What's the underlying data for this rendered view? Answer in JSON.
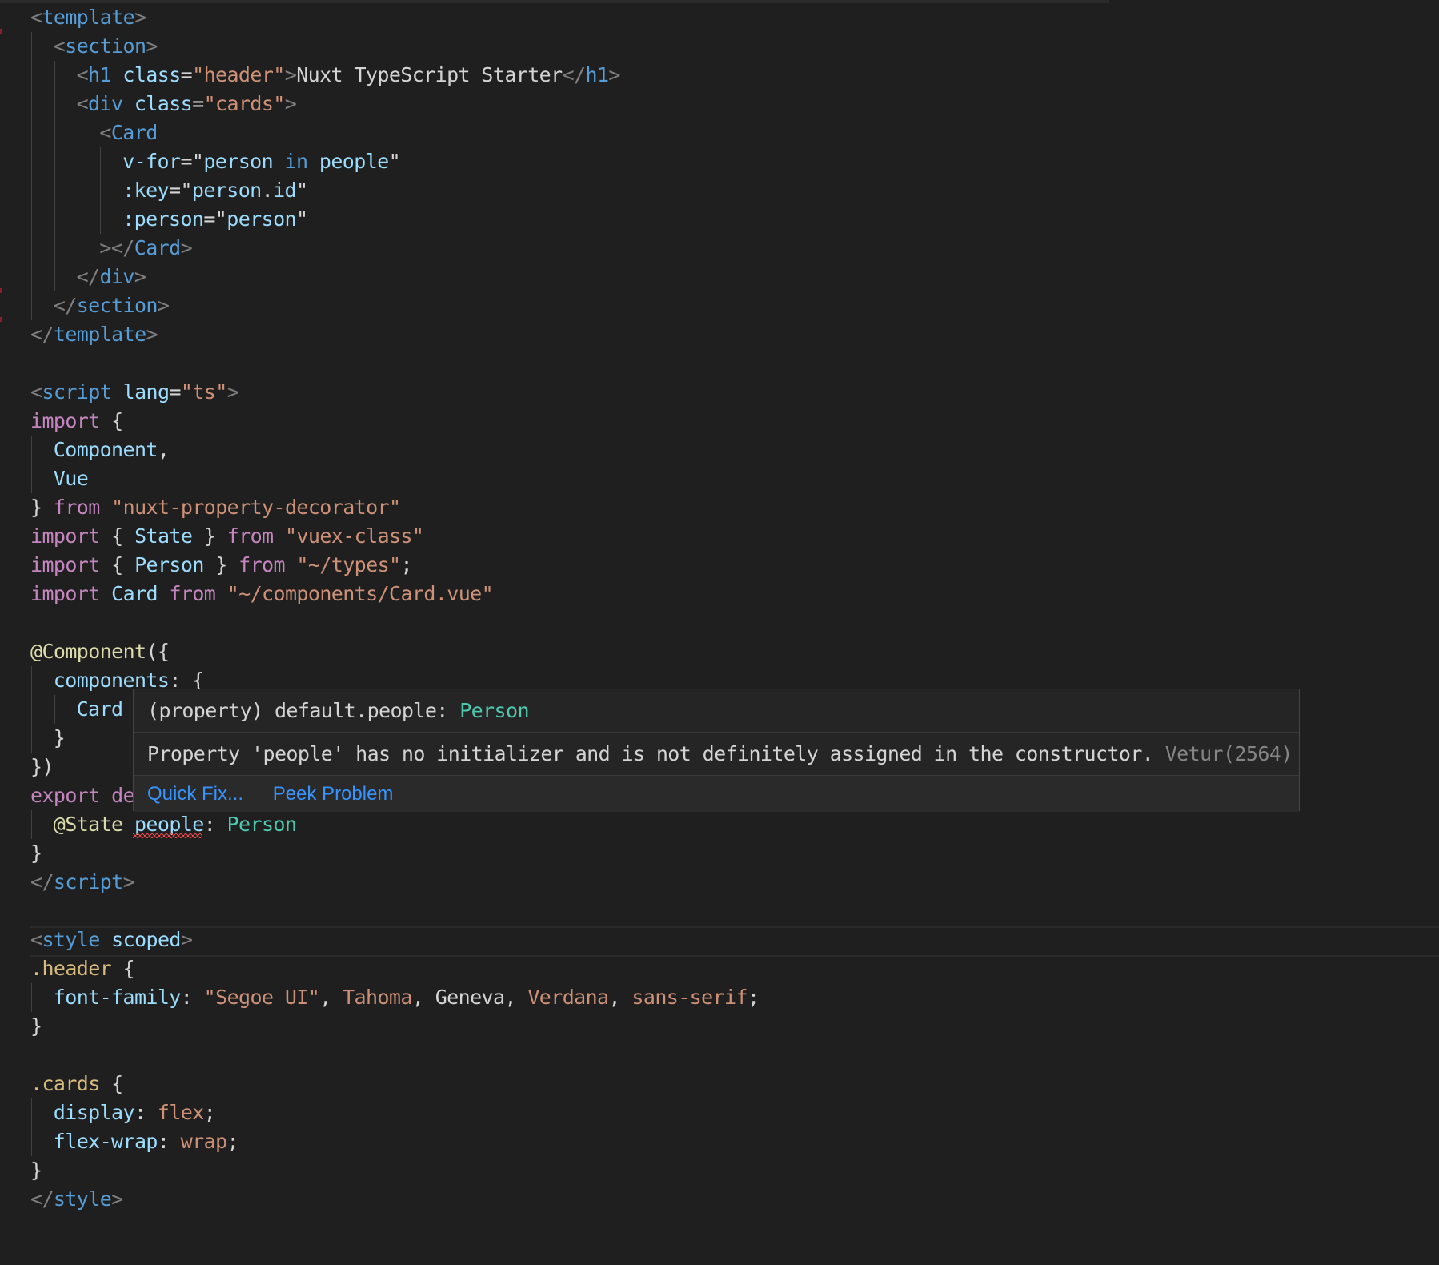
{
  "editor": {
    "lines": [
      [
        [
          "tag",
          "<"
        ],
        [
          "name",
          "template"
        ],
        [
          "tag",
          ">"
        ]
      ],
      [
        [
          "tag",
          "<"
        ],
        [
          "name",
          "section"
        ],
        [
          "tag",
          ">"
        ]
      ],
      [
        [
          "tag",
          "<"
        ],
        [
          "name",
          "h1"
        ],
        [
          "txt",
          " "
        ],
        [
          "attr",
          "class"
        ],
        [
          "txt",
          "="
        ],
        [
          "str",
          "\"header\""
        ],
        [
          "tag",
          ">"
        ],
        [
          "txt",
          "Nuxt TypeScript Starter"
        ],
        [
          "tag",
          "</"
        ],
        [
          "name",
          "h1"
        ],
        [
          "tag",
          ">"
        ]
      ],
      [
        [
          "tag",
          "<"
        ],
        [
          "name",
          "div"
        ],
        [
          "txt",
          " "
        ],
        [
          "attr",
          "class"
        ],
        [
          "txt",
          "="
        ],
        [
          "str",
          "\"cards\""
        ],
        [
          "tag",
          ">"
        ]
      ],
      [
        [
          "tag",
          "<"
        ],
        [
          "name",
          "Card"
        ]
      ],
      [
        [
          "attr",
          "v-for"
        ],
        [
          "txt",
          "=\""
        ],
        [
          "id",
          "person"
        ],
        [
          "txt",
          " "
        ],
        [
          "name",
          "in"
        ],
        [
          "txt",
          " "
        ],
        [
          "id",
          "people"
        ],
        [
          "txt",
          "\""
        ]
      ],
      [
        [
          "attr",
          ":key"
        ],
        [
          "txt",
          "=\""
        ],
        [
          "id",
          "person"
        ],
        [
          "txt",
          "."
        ],
        [
          "id",
          "id"
        ],
        [
          "txt",
          "\""
        ]
      ],
      [
        [
          "attr",
          ":person"
        ],
        [
          "txt",
          "=\""
        ],
        [
          "id",
          "person"
        ],
        [
          "txt",
          "\""
        ]
      ],
      [
        [
          "tag",
          "></"
        ],
        [
          "name",
          "Card"
        ],
        [
          "tag",
          ">"
        ]
      ],
      [
        [
          "tag",
          "</"
        ],
        [
          "name",
          "div"
        ],
        [
          "tag",
          ">"
        ]
      ],
      [
        [
          "tag",
          "</"
        ],
        [
          "name",
          "section"
        ],
        [
          "tag",
          ">"
        ]
      ],
      [
        [
          "tag",
          "</"
        ],
        [
          "name",
          "template"
        ],
        [
          "tag",
          ">"
        ]
      ],
      [],
      [
        [
          "tag",
          "<"
        ],
        [
          "name",
          "script"
        ],
        [
          "txt",
          " "
        ],
        [
          "attr",
          "lang"
        ],
        [
          "txt",
          "="
        ],
        [
          "str",
          "\"ts\""
        ],
        [
          "tag",
          ">"
        ]
      ],
      [
        [
          "kw",
          "import"
        ],
        [
          "txt",
          " {"
        ]
      ],
      [
        [
          "id",
          "Component"
        ],
        [
          "txt",
          ","
        ]
      ],
      [
        [
          "id",
          "Vue"
        ]
      ],
      [
        [
          "txt",
          "} "
        ],
        [
          "kw",
          "from"
        ],
        [
          "txt",
          " "
        ],
        [
          "str",
          "\"nuxt-property-decorator\""
        ]
      ],
      [
        [
          "kw",
          "import"
        ],
        [
          "txt",
          " { "
        ],
        [
          "id",
          "State"
        ],
        [
          "txt",
          " } "
        ],
        [
          "kw",
          "from"
        ],
        [
          "txt",
          " "
        ],
        [
          "str",
          "\"vuex-class\""
        ]
      ],
      [
        [
          "kw",
          "import"
        ],
        [
          "txt",
          " { "
        ],
        [
          "id",
          "Person"
        ],
        [
          "txt",
          " } "
        ],
        [
          "kw",
          "from"
        ],
        [
          "txt",
          " "
        ],
        [
          "str",
          "\"~/types\""
        ],
        [
          "txt",
          ";"
        ]
      ],
      [
        [
          "kw",
          "import"
        ],
        [
          "txt",
          " "
        ],
        [
          "id",
          "Card"
        ],
        [
          "txt",
          " "
        ],
        [
          "kw",
          "from"
        ],
        [
          "txt",
          " "
        ],
        [
          "str",
          "\"~/components/Card.vue\""
        ]
      ],
      [],
      [
        [
          "dec",
          "@Component"
        ],
        [
          "txt",
          "({"
        ]
      ],
      [
        [
          "id",
          "components"
        ],
        [
          "txt",
          ": {"
        ]
      ],
      [
        [
          "id",
          "Card"
        ]
      ],
      [
        [
          "txt",
          "}"
        ]
      ],
      [
        [
          "txt",
          "})"
        ]
      ],
      [
        [
          "kw",
          "export"
        ],
        [
          "txt",
          " "
        ],
        [
          "kw",
          "de"
        ]
      ],
      [
        [
          "dec",
          "@State"
        ],
        [
          "txt",
          " "
        ],
        [
          "id",
          "people"
        ],
        [
          "txt",
          ": "
        ],
        [
          "type",
          "Person"
        ]
      ],
      [
        [
          "txt",
          "}"
        ]
      ],
      [
        [
          "tag",
          "</"
        ],
        [
          "name",
          "script"
        ],
        [
          "tag",
          ">"
        ]
      ],
      [],
      [
        [
          "tag",
          "<"
        ],
        [
          "name",
          "style"
        ],
        [
          "txt",
          " "
        ],
        [
          "attr",
          "scoped"
        ],
        [
          "tag",
          ">"
        ]
      ],
      [
        [
          "sel",
          ".header"
        ],
        [
          "txt",
          " {"
        ]
      ],
      [
        [
          "attr",
          "font-family"
        ],
        [
          "txt",
          ": "
        ],
        [
          "val",
          "\"Segoe UI\""
        ],
        [
          "txt",
          ", "
        ],
        [
          "val",
          "Tahoma"
        ],
        [
          "txt",
          ", "
        ],
        [
          "txt",
          "Geneva"
        ],
        [
          "txt",
          ", "
        ],
        [
          "val",
          "Verdana"
        ],
        [
          "txt",
          ", "
        ],
        [
          "val",
          "sans-serif"
        ],
        [
          "txt",
          ";"
        ]
      ],
      [
        [
          "txt",
          "}"
        ]
      ],
      [],
      [
        [
          "sel",
          ".cards"
        ],
        [
          "txt",
          " {"
        ]
      ],
      [
        [
          "attr",
          "display"
        ],
        [
          "txt",
          ": "
        ],
        [
          "val",
          "flex"
        ],
        [
          "txt",
          ";"
        ]
      ],
      [
        [
          "attr",
          "flex-wrap"
        ],
        [
          "txt",
          ": "
        ],
        [
          "val",
          "wrap"
        ],
        [
          "txt",
          ";"
        ]
      ],
      [
        [
          "txt",
          "}"
        ]
      ],
      [
        [
          "tag",
          "</"
        ],
        [
          "name",
          "style"
        ],
        [
          "tag",
          ">"
        ]
      ]
    ]
  },
  "hover": {
    "signature_prefix": "(property) default.people: ",
    "signature_type": "Person",
    "message": "Property 'people' has no initializer and is not definitely assigned in the constructor.",
    "source": "Vetur(2564)",
    "quick_fix_label": "Quick Fix...",
    "peek_problem_label": "Peek Problem"
  },
  "colors": {
    "background": "#1f1f1f",
    "tag_bracket": "#808080",
    "tag_name": "#569cd6",
    "attribute": "#9cdcfe",
    "string": "#ce9178",
    "keyword": "#c586c0",
    "decorator": "#dcdcaa",
    "type": "#4ec9b0",
    "selector": "#d7ba7d",
    "link": "#3794ff",
    "error": "#f14c4c"
  }
}
